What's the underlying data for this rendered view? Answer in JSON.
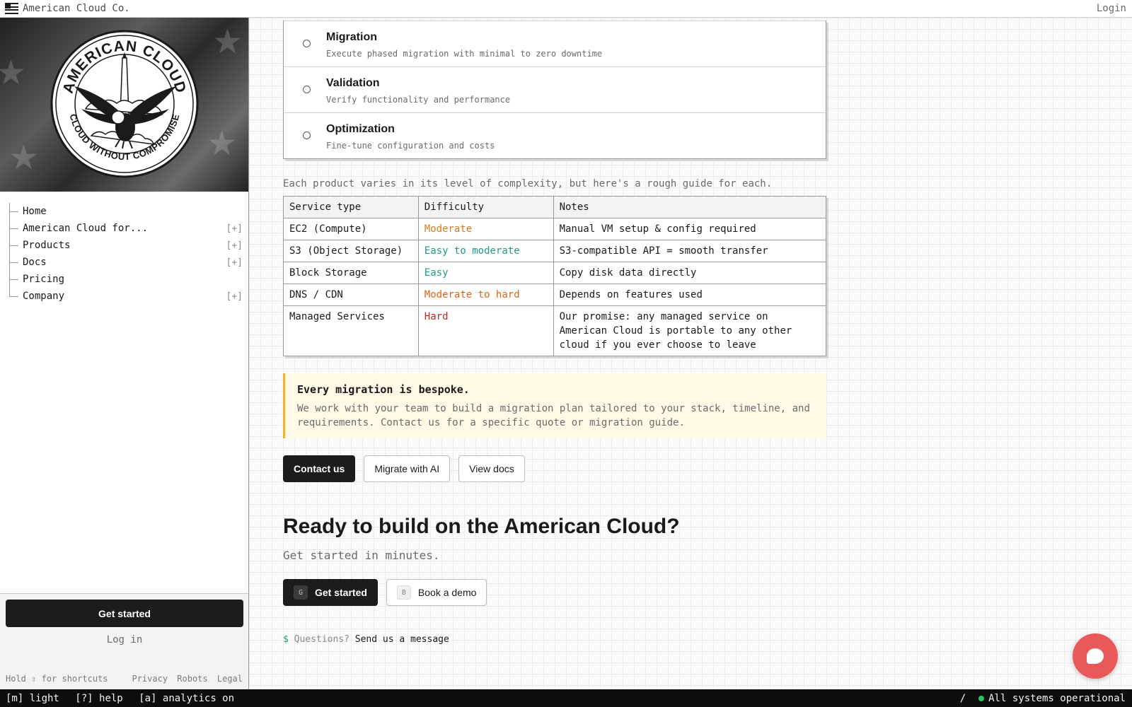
{
  "brand": {
    "name": "American Cloud Co.",
    "flag_icon": "us-flag-icon"
  },
  "header": {
    "login_label": "Login"
  },
  "seal": {
    "top_text": "AMERICAN CLOUD",
    "bottom_text": "CLOUD WITHOUT COMPROMISE"
  },
  "sidebar": {
    "items": [
      {
        "label": "Home",
        "toggle": ""
      },
      {
        "label": "American Cloud for...",
        "toggle": "[+]"
      },
      {
        "label": "Products",
        "toggle": "[+]"
      },
      {
        "label": "Docs",
        "toggle": "[+]"
      },
      {
        "label": "Pricing",
        "toggle": ""
      },
      {
        "label": "Company",
        "toggle": "[+]"
      }
    ],
    "get_started_label": "Get started",
    "login_label": "Log in",
    "shortcut_hint": "Hold ⇧ for shortcuts",
    "footer_links": [
      "Privacy",
      "Robots",
      "Legal"
    ]
  },
  "steps": [
    {
      "title": "Migration",
      "desc": "Execute phased migration with minimal to zero downtime"
    },
    {
      "title": "Validation",
      "desc": "Verify functionality and performance"
    },
    {
      "title": "Optimization",
      "desc": "Fine-tune configuration and costs"
    }
  ],
  "guide": {
    "intro": "Each product varies in its level of complexity, but here's a rough guide for each.",
    "headers": [
      "Service type",
      "Difficulty",
      "Notes"
    ],
    "rows": [
      {
        "service": "EC2 (Compute)",
        "difficulty": "Moderate",
        "notes": "Manual VM setup & config required"
      },
      {
        "service": "S3 (Object Storage)",
        "difficulty": "Easy to moderate",
        "notes": "S3-compatible API = smooth transfer"
      },
      {
        "service": "Block Storage",
        "difficulty": "Easy",
        "notes": "Copy disk data directly"
      },
      {
        "service": "DNS / CDN",
        "difficulty": "Moderate to hard",
        "notes": "Depends on features used"
      },
      {
        "service": "Managed Services",
        "difficulty": "Hard",
        "notes": "Our promise: any managed service on American Cloud is portable to any other cloud if you ever choose to leave"
      }
    ]
  },
  "callout": {
    "title": "Every migration is bespoke.",
    "body": "We work with your team to build a migration plan tailored to your stack, timeline, and requirements. Contact us for a specific quote or migration guide."
  },
  "actions": {
    "contact_label": "Contact us",
    "migrate_ai_label": "Migrate with AI",
    "view_docs_label": "View docs"
  },
  "cta": {
    "title": "Ready to build on the American Cloud?",
    "subtitle": "Get started in minutes.",
    "get_started_label": "Get started",
    "get_started_key": "G",
    "demo_label": "Book a demo",
    "demo_key": "B"
  },
  "questions": {
    "prompt": "$",
    "label": "Questions?",
    "link": "Send us a message"
  },
  "statusbar": {
    "theme": "[m] light",
    "help": "[?] help",
    "analytics": "[a] analytics on",
    "slash": "/",
    "system_status": "All systems operational"
  },
  "colors": {
    "moderate": "#d97a1a",
    "easy": "#1f9a87",
    "moderate_to_hard": "#d9661a",
    "hard": "#c22626",
    "status_ok": "#22c55e",
    "chat_accent": "#e85a5a"
  }
}
